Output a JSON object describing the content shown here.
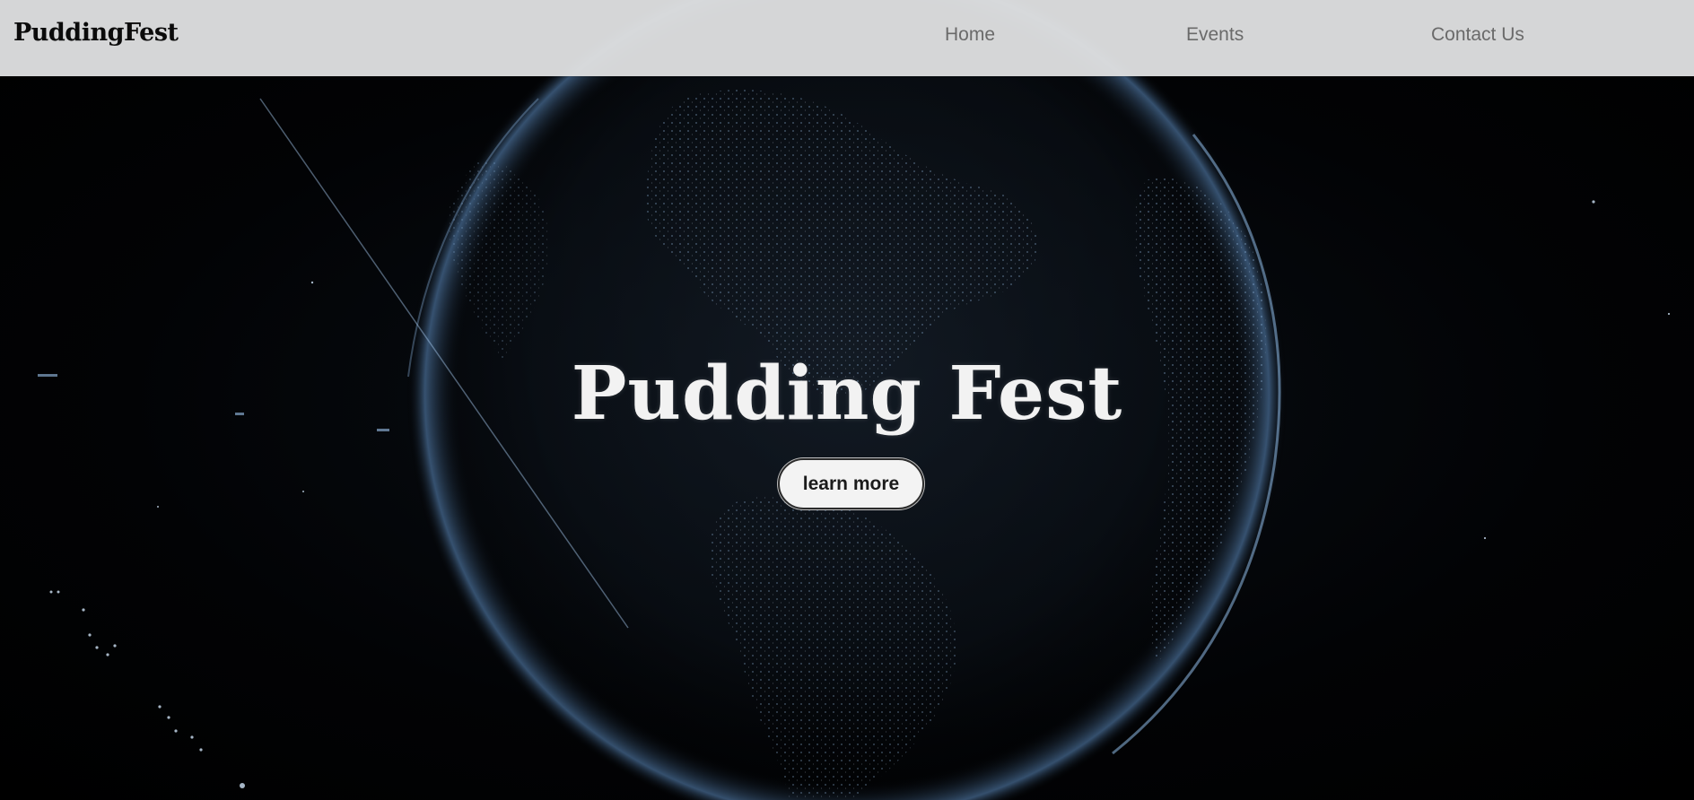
{
  "header": {
    "logo": "PuddingFest",
    "nav": [
      {
        "label": "Home"
      },
      {
        "label": "Events"
      },
      {
        "label": "Contact Us"
      }
    ]
  },
  "hero": {
    "title": "Pudding Fest",
    "cta_label": "learn more",
    "background": "digital-globe-image"
  },
  "colors": {
    "header_bg": "#dedfe0",
    "hero_bg": "#000000",
    "title": "#f2f2f2",
    "button_bg": "#f3f3f3",
    "globe_glow": "#7fb2e5"
  }
}
